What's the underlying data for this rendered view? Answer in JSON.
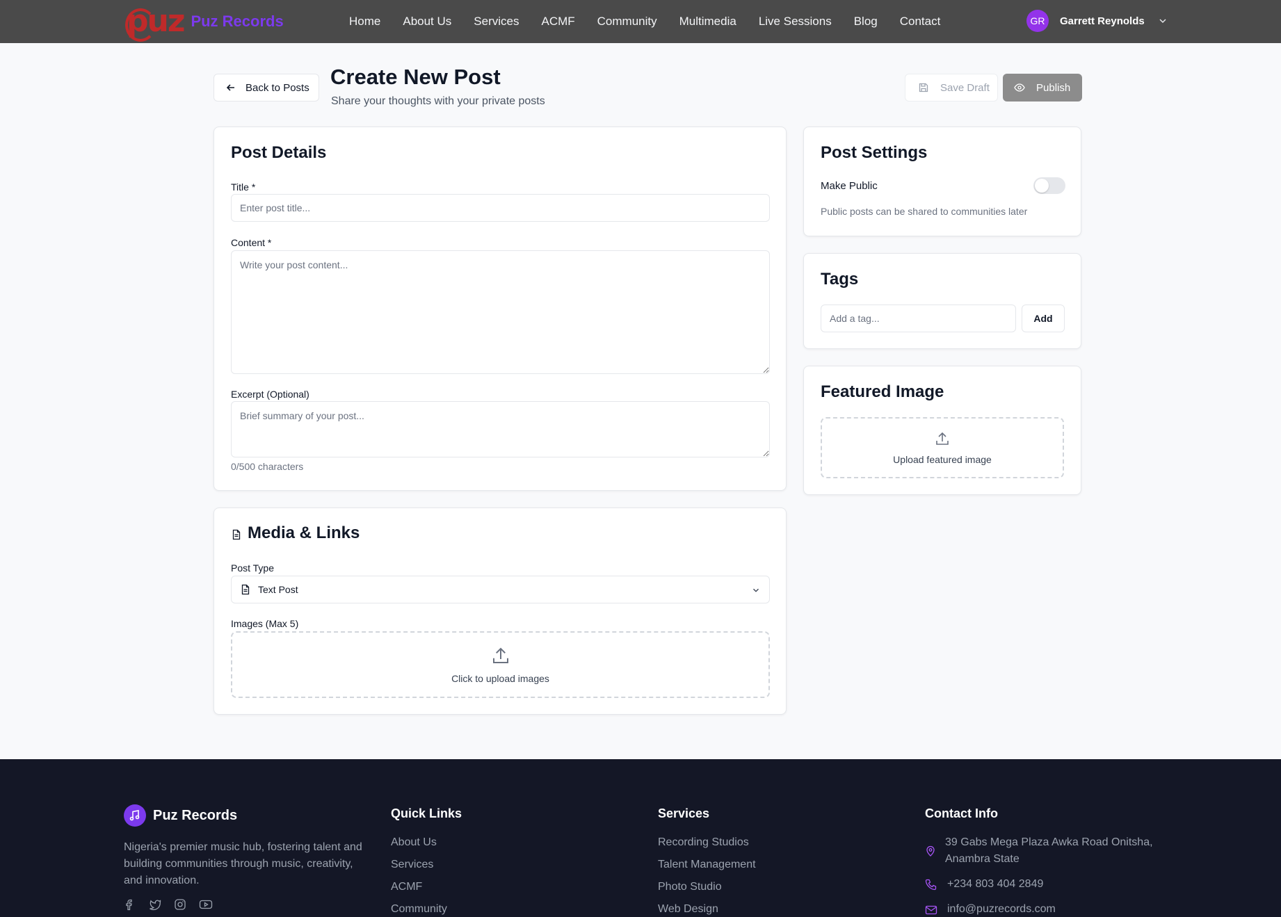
{
  "nav": {
    "logo_mark": "puz",
    "logo_text": "Puz Records",
    "links": [
      "Home",
      "About Us",
      "Services",
      "ACMF",
      "Community",
      "Multimedia",
      "Live Sessions",
      "Blog",
      "Contact"
    ],
    "user_initials": "GR",
    "user_name": "Garrett Reynolds"
  },
  "header": {
    "back_label": "Back to Posts",
    "title": "Create New Post",
    "subtitle": "Share your thoughts with your private posts",
    "save_draft_label": "Save Draft",
    "publish_label": "Publish"
  },
  "post_details": {
    "title": "Post Details",
    "title_label": "Title *",
    "title_placeholder": "Enter post title...",
    "title_value": "",
    "content_label": "Content *",
    "content_placeholder": "Write your post content...",
    "excerpt_label": "Excerpt (Optional)",
    "excerpt_placeholder": "Brief summary of your post...",
    "char_count": "0/500 characters"
  },
  "media": {
    "title": "Media & Links",
    "post_type_label": "Post Type",
    "post_type_value": "Text Post",
    "images_label": "Images (Max 5)",
    "upload_label": "Click to upload images"
  },
  "settings": {
    "title": "Post Settings",
    "make_public_label": "Make Public",
    "make_public_on": false,
    "hint": "Public posts can be shared to communities later"
  },
  "tags": {
    "title": "Tags",
    "placeholder": "Add a tag...",
    "add_label": "Add"
  },
  "featured": {
    "title": "Featured Image",
    "upload_label": "Upload featured image"
  },
  "footer": {
    "brand": "Puz Records",
    "description": "Nigeria's premier music hub, fostering talent and building communities through music, creativity, and innovation.",
    "social_icons": [
      "facebook-icon",
      "twitter-icon",
      "instagram-icon",
      "youtube-icon"
    ],
    "quick_links_title": "Quick Links",
    "quick_links": [
      "About Us",
      "Services",
      "ACMF",
      "Community"
    ],
    "services_title": "Services",
    "services": [
      "Recording Studios",
      "Talent Management",
      "Photo Studio",
      "Web Design"
    ],
    "contact_title": "Contact Info",
    "address": "39 Gabs Mega Plaza Awka Road Onitsha, Anambra State",
    "phone": "+234 803 404 2849",
    "email": "info@puzrecords.com"
  },
  "colors": {
    "nav_bg": "#4a4a4a",
    "accent": "#9333ea",
    "footer_bg": "#141726",
    "publish_bg": "#8c8c8c"
  }
}
